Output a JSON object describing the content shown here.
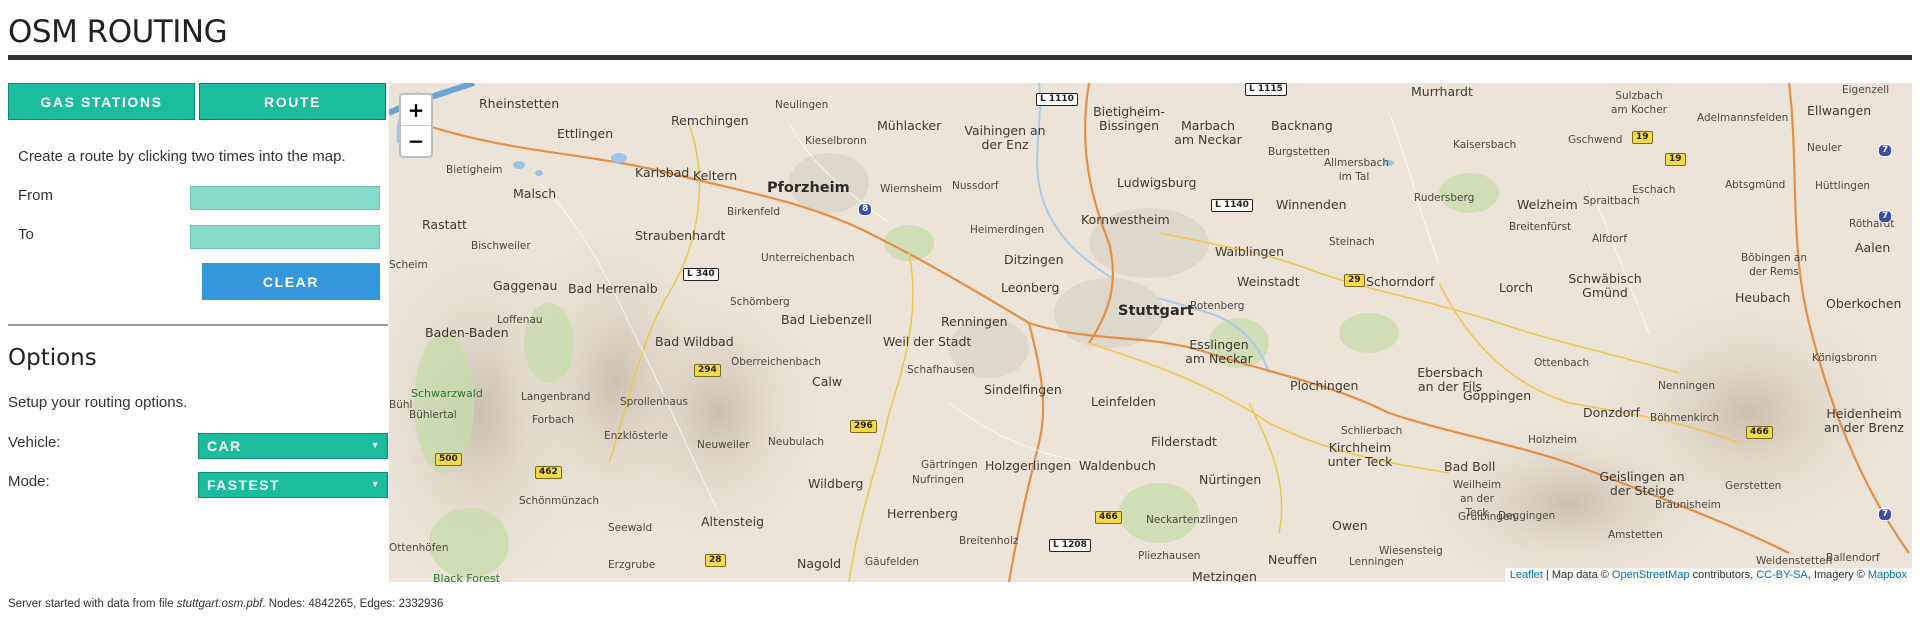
{
  "app": {
    "title": "OSM ROUTING"
  },
  "tabs": {
    "gas_stations": "GAS STATIONS",
    "route": "ROUTE"
  },
  "route_panel": {
    "instructions": "Create a route by clicking two times into the map.",
    "from_label": "From",
    "from_value": "",
    "to_label": "To",
    "to_value": "",
    "clear_label": "CLEAR"
  },
  "options": {
    "heading": "Options",
    "description": "Setup your routing options.",
    "vehicle_label": "Vehicle:",
    "vehicle_value": "CAR",
    "mode_label": "Mode:",
    "mode_value": "FASTEST"
  },
  "map": {
    "zoom_in": "+",
    "zoom_out": "−",
    "attribution": {
      "leaflet": "Leaflet",
      "sep1": " | Map data © ",
      "osm": "OpenStreetMap",
      "sep2": " contributors, ",
      "license": "CC-BY-SA",
      "sep3": ", Imagery © ",
      "mapbox": "Mapbox"
    },
    "places": [
      "Rheinstetten",
      "Ettlingen",
      "Remchingen",
      "Neulingen",
      "Mühlacker",
      "Vaihingen an der Enz",
      "Bietigheim-Bissingen",
      "Marbach am Neckar",
      "Backnang",
      "Murrhardt",
      "Sulzbach am Kocher",
      "Ellwangen",
      "Adelmannsfelden",
      "Eigenzell",
      "Bietigheim",
      "Malsch",
      "Karlsbad",
      "Keltern",
      "Kieselbronn",
      "Pforzheim",
      "Wiernsheim",
      "Nussdorf",
      "Ludwigsburg",
      "Burgstetten",
      "Allmersbach im Tal",
      "Kaisersbach",
      "Gschwend",
      "Eschach",
      "Abtsgmünd",
      "Hüttlingen",
      "Neuler",
      "Rastatt",
      "Bischweiler",
      "Straubenhardt",
      "Birkenfeld",
      "Heimerdingen",
      "Kornwestheim",
      "Winnenden",
      "Rudersberg",
      "Welzheim",
      "Breitenfürst",
      "Spraitbach",
      "Alfdorf",
      "Röthardt",
      "Aalen",
      "Gaggenau",
      "Bad Herrenalb",
      "Unterreichenbach",
      "Ditzingen",
      "Waiblingen",
      "Steinach",
      "Schorndorf",
      "Lorch",
      "Schwäbisch Gmünd",
      "Böbingen an der Rems",
      "Heubach",
      "Oberkochen",
      "Loffenau",
      "Schömberg",
      "Bad Liebenzell",
      "Leonberg",
      "Stuttgart",
      "Rotenberg",
      "Weinstadt",
      "Baden-Baden",
      "Bad Wildbad",
      "Weil der Stadt",
      "Renningen",
      "Esslingen am Neckar",
      "Ottenbach",
      "Königsbronn",
      "Oberreichenbach",
      "Schafhausen",
      "Calw",
      "Sindelfingen",
      "Leinfelden",
      "Plochingen",
      "Ebersbach an der Fils",
      "Göppingen",
      "Nenningen",
      "Donzdorf",
      "Böhmenkirch",
      "Heidenheim an der Brenz",
      "Schwarzwald",
      "Langenbrand",
      "Sprollenhaus",
      "Forbach",
      "Enzklösterle",
      "Neuweiler",
      "Neubulach",
      "Holzgerlingen",
      "Waldenbuch",
      "Filderstadt",
      "Schlierbach",
      "Holzheim",
      "Bühlertal",
      "Gärtringen",
      "Nufringen",
      "Wildberg",
      "Herrenberg",
      "Nürtingen",
      "Kirchheim unter Teck",
      "Bad Boll",
      "Geislingen an der Steige",
      "Gerstetten",
      "Schönmünzach",
      "Seewald",
      "Altensteig",
      "Breitenholz",
      "Neckartenzlingen",
      "Weilheim an der Teck",
      "Gruibingen",
      "Deggingen",
      "Bräunisheim",
      "Owen",
      "Wiesensteig",
      "Amstetten",
      "Erzgrube",
      "Nagold",
      "Gäufelden",
      "Pliezhausen",
      "Neuffen",
      "Lenningen",
      "Weidenstetten",
      "Ballendorf",
      "Black Forest",
      "Metzingen",
      "Bühl",
      "Scheim",
      "Ottenhöfen"
    ],
    "roads": [
      "L 1110",
      "L 1115",
      "L 1140",
      "L 340",
      "L 1208",
      "8",
      "19",
      "19",
      "29",
      "294",
      "296",
      "462",
      "500",
      "466",
      "466",
      "28",
      "7",
      "7",
      "7"
    ]
  },
  "status": {
    "prefix": "Server started with data from file ",
    "file": "stuttgart.osm.pbf",
    "suffix": ". Nodes: 4842265, Edges: 2332936"
  },
  "colors": {
    "accent": "#1abc9c",
    "button_blue": "#3498db",
    "input_fill": "#85dbc8",
    "link": "#0078a8"
  }
}
